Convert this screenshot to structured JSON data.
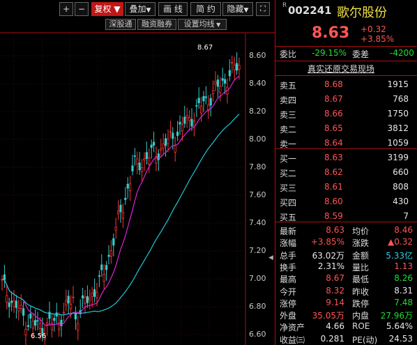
{
  "toolbar": {
    "plus": "+",
    "minus": "−",
    "fuquan": "复权",
    "diejia": "叠加",
    "huaxian": "画 线",
    "jianyue": "简 约",
    "yincang": "隐藏",
    "shenguton": "深股通",
    "rongzi": "融资融券",
    "junxian": "设置均线"
  },
  "yaxis": [
    "8.60",
    "8.40",
    "8.20",
    "8.00",
    "7.80",
    "7.60",
    "7.40",
    "7.20",
    "7.00",
    "6.80",
    "6.60"
  ],
  "annotations": {
    "high": "8.67",
    "low": "6.56"
  },
  "quote": {
    "code_prefix": "R",
    "code": "002241",
    "name": "歌尔股份",
    "price": "8.63",
    "change": "+0.32",
    "change_pct": "+3.85%",
    "weibi_label": "委比",
    "weibi": "-29.15%",
    "weicha_label": "委差",
    "weicha": "-4200",
    "section_title": "真实还原交易现场"
  },
  "asks": [
    {
      "label": "卖五",
      "price": "8.68",
      "vol": "1915"
    },
    {
      "label": "卖四",
      "price": "8.67",
      "vol": "768"
    },
    {
      "label": "卖三",
      "price": "8.66",
      "vol": "1750"
    },
    {
      "label": "卖二",
      "price": "8.65",
      "vol": "3812"
    },
    {
      "label": "卖一",
      "price": "8.64",
      "vol": "1059"
    }
  ],
  "bids": [
    {
      "label": "买一",
      "price": "8.63",
      "vol": "3199"
    },
    {
      "label": "买二",
      "price": "8.62",
      "vol": "660"
    },
    {
      "label": "买三",
      "price": "8.61",
      "vol": "808"
    },
    {
      "label": "买四",
      "price": "8.60",
      "vol": "430"
    },
    {
      "label": "买五",
      "price": "8.59",
      "vol": "7"
    }
  ],
  "stats": [
    {
      "l1": "最新",
      "v1": "8.63",
      "c1": "red",
      "l2": "均价",
      "v2": "8.46",
      "c2": "red"
    },
    {
      "l1": "涨幅",
      "v1": "+3.85%",
      "c1": "red",
      "l2": "涨跌",
      "v2": "▲0.32",
      "c2": "red"
    },
    {
      "l1": "总手",
      "v1": "63.02万",
      "c1": "white",
      "l2": "金额",
      "v2": "5.33亿",
      "c2": "cyan"
    },
    {
      "l1": "换手",
      "v1": "2.31%",
      "c1": "white",
      "l2": "量比",
      "v2": "1.13",
      "c2": "red"
    },
    {
      "l1": "最高",
      "v1": "8.67",
      "c1": "red",
      "l2": "最低",
      "v2": "8.26",
      "c2": "green"
    },
    {
      "l1": "今开",
      "v1": "8.32",
      "c1": "red",
      "l2": "昨收",
      "v2": "8.31",
      "c2": "white"
    },
    {
      "l1": "涨停",
      "v1": "9.14",
      "c1": "red",
      "l2": "跌停",
      "v2": "7.48",
      "c2": "green"
    },
    {
      "l1": "外盘",
      "v1": "35.05万",
      "c1": "red",
      "l2": "内盘",
      "v2": "27.96万",
      "c2": "green"
    },
    {
      "l1": "净资产",
      "v1": "4.66",
      "c1": "white",
      "l2": "ROE",
      "v2": "5.64%",
      "c2": "white"
    },
    {
      "l1": "收益㈢",
      "v1": "0.281",
      "c1": "white",
      "l2": "PE(动)",
      "v2": "24.53",
      "c2": "white"
    }
  ],
  "colors": {
    "up": "#ff3333",
    "down": "#33cccc",
    "ma1": "#e020e0",
    "ma2": "#20c8d8",
    "border": "#b01010"
  }
}
